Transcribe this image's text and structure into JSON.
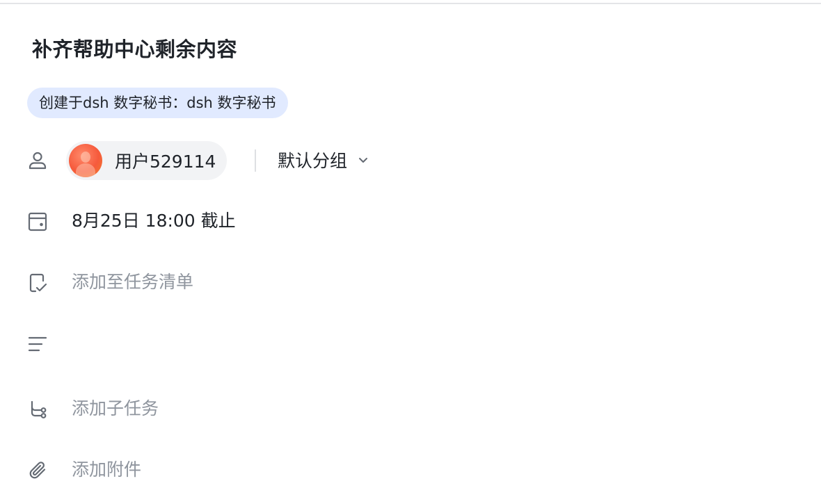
{
  "task": {
    "title": "补齐帮助中心剩余内容",
    "source_tag": "创建于dsh 数字秘书：dsh 数字秘书"
  },
  "assignee": {
    "name": "用户529114",
    "icon": "user-icon"
  },
  "group": {
    "label": "默认分组",
    "icon": "chevron-down-icon"
  },
  "due": {
    "text": "8月25日 18:00 截止",
    "icon": "calendar-icon"
  },
  "tasklist": {
    "placeholder": "添加至任务清单",
    "icon": "tasklist-icon"
  },
  "description": {
    "icon": "text-lines-icon"
  },
  "subtask": {
    "placeholder": "添加子任务",
    "icon": "subtask-icon"
  },
  "attachment": {
    "placeholder": "添加附件",
    "icon": "paperclip-icon"
  },
  "colors": {
    "tag_bg": "#e1eaff",
    "chip_bg": "#f2f3f5",
    "placeholder": "#8f959e",
    "text": "#1f2329",
    "icon": "#646a73"
  }
}
